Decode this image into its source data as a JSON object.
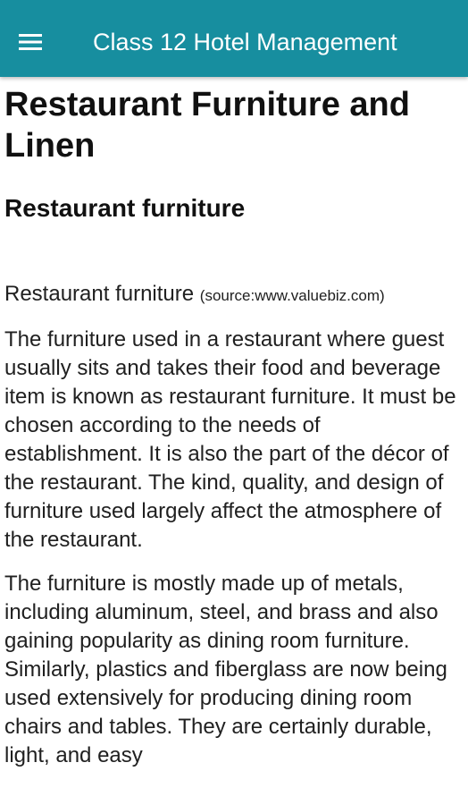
{
  "app_bar": {
    "title": "Class 12 Hotel Management",
    "menu_icon": "hamburger-menu-icon",
    "background_color": "#178e9f"
  },
  "article": {
    "title": "Restaurant Furniture and Linen",
    "section_heading": "Restaurant furniture",
    "figure_caption": "Restaurant furniture",
    "figure_source": "(source:www.valuebiz.com)",
    "paragraphs": [
      "The furniture used in a restaurant where guest usually sits and takes their food and beverage item is known as restaurant furniture. It must be chosen according to the needs of establishment. It is also the part of the décor of the restaurant. The kind, quality, and design of furniture used largely affect the atmosphere of the restaurant.",
      "The furniture is mostly made up of metals, including aluminum, steel, and brass and also gaining popularity as dining room furniture. Similarly, plastics and fiberglass are now being used extensively for producing dining room chairs and tables. They are certainly durable, light, and easy"
    ]
  }
}
